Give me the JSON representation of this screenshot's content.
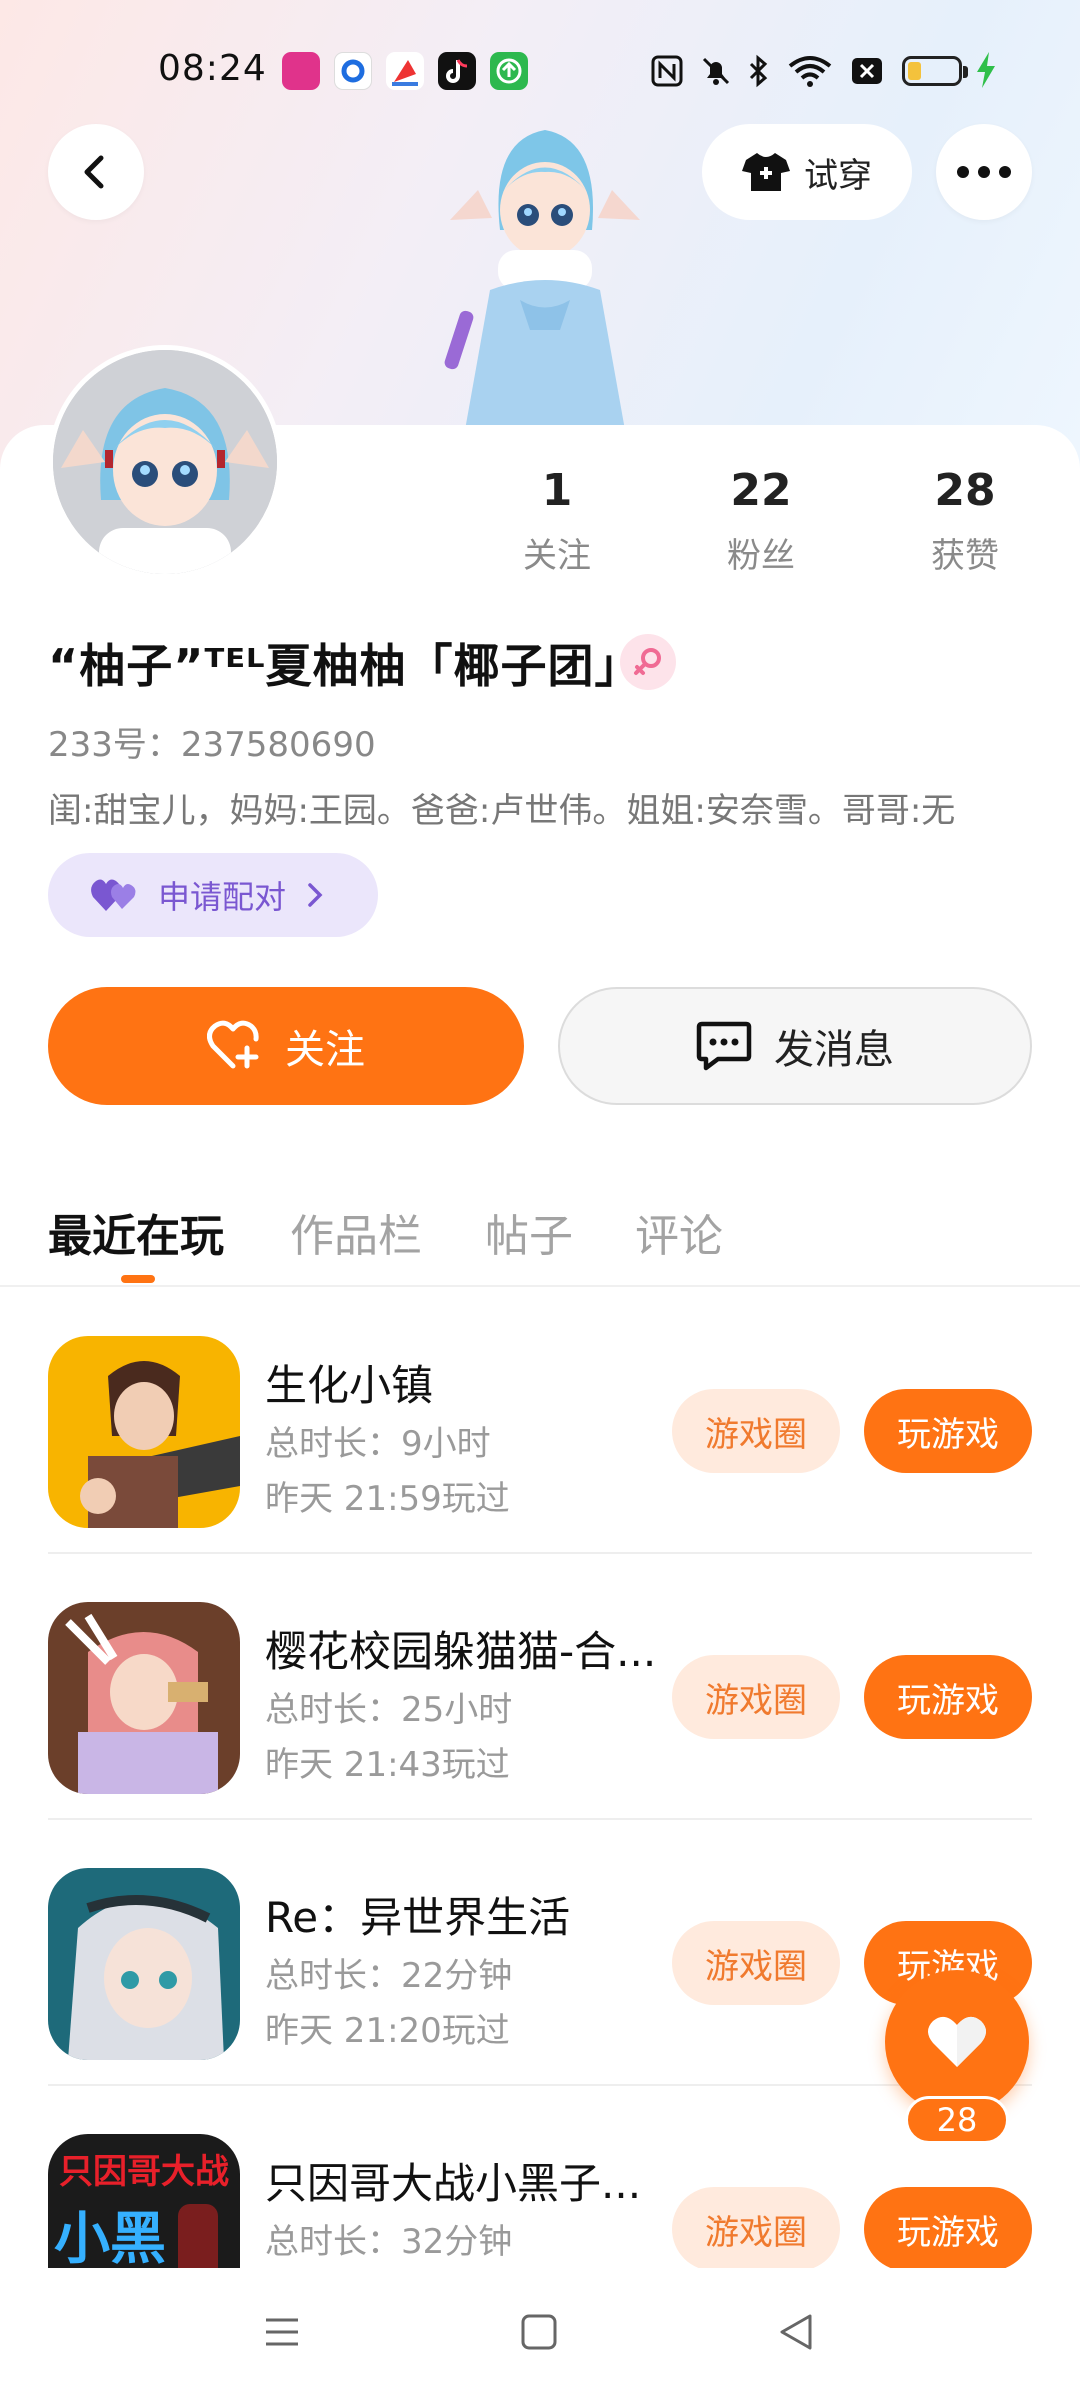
{
  "status_bar": {
    "time": "08:24",
    "app_icons": [
      "app-icon-1",
      "app-icon-2",
      "app-icon-3",
      "tiktok-icon",
      "upload-icon"
    ],
    "system_icons": [
      "nfc-icon",
      "mute-icon",
      "bluetooth-icon",
      "wifi-icon",
      "no-sim-icon",
      "battery-icon",
      "charging-icon"
    ]
  },
  "header": {
    "try_on_label": "试穿"
  },
  "profile": {
    "stats": [
      {
        "num": "1",
        "label": "关注"
      },
      {
        "num": "22",
        "label": "粉丝"
      },
      {
        "num": "28",
        "label": "获赞"
      }
    ],
    "name": "“柚子”ᵀᴱᴸ夏柚柚「椰子团」",
    "uid": "233号：237580690",
    "bio": "闺:甜宝儿，妈妈:王园。爸爸:卢世伟。姐姐:安奈雪。哥哥:无",
    "pair_label": "申请配对",
    "follow_label": "关注",
    "message_label": "发消息"
  },
  "tabs": [
    "最近在玩",
    "作品栏",
    "帖子",
    "评论"
  ],
  "games": [
    {
      "title": "生化小镇",
      "duration": "总时长：9小时",
      "last_played": "昨天 21:59玩过",
      "circle_label": "游戏圈",
      "play_label": "玩游戏"
    },
    {
      "title": "樱花校园躲猫猫-合...",
      "duration": "总时长：25小时",
      "last_played": "昨天 21:43玩过",
      "circle_label": "游戏圈",
      "play_label": "玩游戏"
    },
    {
      "title": "Re：异世界生活",
      "duration": "总时长：22分钟",
      "last_played": "昨天 21:20玩过",
      "circle_label": "游戏圈",
      "play_label": "玩游戏"
    },
    {
      "title": "只因哥大战小黑子...",
      "duration": "总时长：32分钟",
      "last_played": "",
      "circle_label": "游戏圈",
      "play_label": "玩游戏"
    }
  ],
  "thumb4_text": {
    "line1": "只因哥大战",
    "line2": "小黑"
  },
  "like_fab": {
    "count": "28"
  },
  "colors": {
    "accent": "#ff7313",
    "pair_bg": "#ebe6fb",
    "pair_text": "#7a57d1"
  }
}
